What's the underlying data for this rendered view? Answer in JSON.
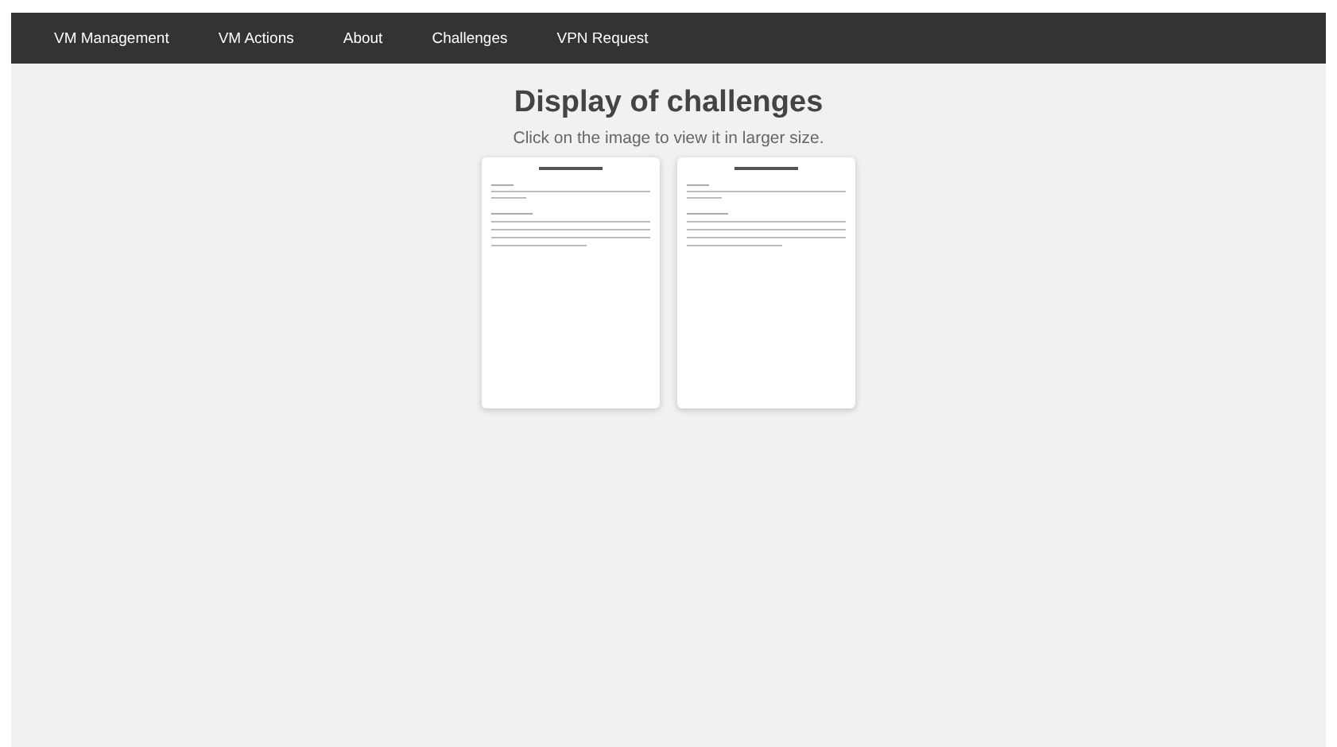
{
  "nav": {
    "items": [
      {
        "label": "VM Management"
      },
      {
        "label": "VM Actions"
      },
      {
        "label": "About"
      },
      {
        "label": "Challenges"
      },
      {
        "label": "VPN Request"
      }
    ]
  },
  "heading": "Display of challenges",
  "subtitle": "Click on the image to view it in larger size."
}
